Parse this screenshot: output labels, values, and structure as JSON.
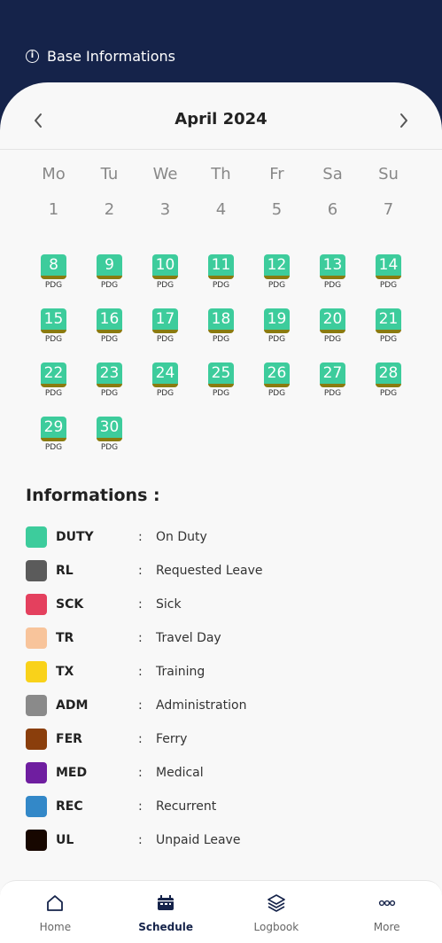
{
  "header": {
    "base_info_label": "Base Informations"
  },
  "calendar": {
    "month_title": "April 2024",
    "weekdays": [
      "Mo",
      "Tu",
      "We",
      "Th",
      "Fr",
      "Sa",
      "Su"
    ],
    "plain_days": [
      "1",
      "2",
      "3",
      "4",
      "5",
      "6",
      "7"
    ],
    "scheduled_days": [
      {
        "day": "8",
        "code": "PDG"
      },
      {
        "day": "9",
        "code": "PDG"
      },
      {
        "day": "10",
        "code": "PDG"
      },
      {
        "day": "11",
        "code": "PDG"
      },
      {
        "day": "12",
        "code": "PDG"
      },
      {
        "day": "13",
        "code": "PDG"
      },
      {
        "day": "14",
        "code": "PDG"
      },
      {
        "day": "15",
        "code": "PDG"
      },
      {
        "day": "16",
        "code": "PDG"
      },
      {
        "day": "17",
        "code": "PDG"
      },
      {
        "day": "18",
        "code": "PDG"
      },
      {
        "day": "19",
        "code": "PDG"
      },
      {
        "day": "20",
        "code": "PDG"
      },
      {
        "day": "21",
        "code": "PDG"
      },
      {
        "day": "22",
        "code": "PDG"
      },
      {
        "day": "23",
        "code": "PDG"
      },
      {
        "day": "24",
        "code": "PDG"
      },
      {
        "day": "25",
        "code": "PDG"
      },
      {
        "day": "26",
        "code": "PDG"
      },
      {
        "day": "27",
        "code": "PDG"
      },
      {
        "day": "28",
        "code": "PDG"
      },
      {
        "day": "29",
        "code": "PDG"
      },
      {
        "day": "30",
        "code": "PDG"
      }
    ]
  },
  "informations": {
    "title": "Informations :",
    "items": [
      {
        "code": "DUTY",
        "colon": ":",
        "label": "On Duty",
        "color": "#3dcc9c"
      },
      {
        "code": "RL",
        "colon": ":",
        "label": "Requested Leave",
        "color": "#5b5b5b"
      },
      {
        "code": "SCK",
        "colon": ":",
        "label": "Sick",
        "color": "#e4405e"
      },
      {
        "code": "TR",
        "colon": ":",
        "label": "Travel Day",
        "color": "#f8c49b"
      },
      {
        "code": "TX",
        "colon": ":",
        "label": "Training",
        "color": "#f9d21a"
      },
      {
        "code": "ADM",
        "colon": ":",
        "label": "Administration",
        "color": "#8a8a8a"
      },
      {
        "code": "FER",
        "colon": ":",
        "label": "Ferry",
        "color": "#8a3e0c"
      },
      {
        "code": "MED",
        "colon": ":",
        "label": "Medical",
        "color": "#6f1ea0"
      },
      {
        "code": "REC",
        "colon": ":",
        "label": "Recurrent",
        "color": "#3388c8"
      },
      {
        "code": "UL",
        "colon": ":",
        "label": "Unpaid Leave",
        "color": "#170700"
      }
    ]
  },
  "bottom_nav": {
    "items": [
      {
        "label": "Home",
        "icon": "home-icon",
        "active": false
      },
      {
        "label": "Schedule",
        "icon": "calendar-icon",
        "active": true
      },
      {
        "label": "Logbook",
        "icon": "layers-icon",
        "active": false
      },
      {
        "label": "More",
        "icon": "more-dots-icon",
        "active": false
      }
    ]
  },
  "colors": {
    "header_bg": "#15234a",
    "duty_day": "#3dcc9c",
    "duty_underline": "#8a7b10"
  }
}
